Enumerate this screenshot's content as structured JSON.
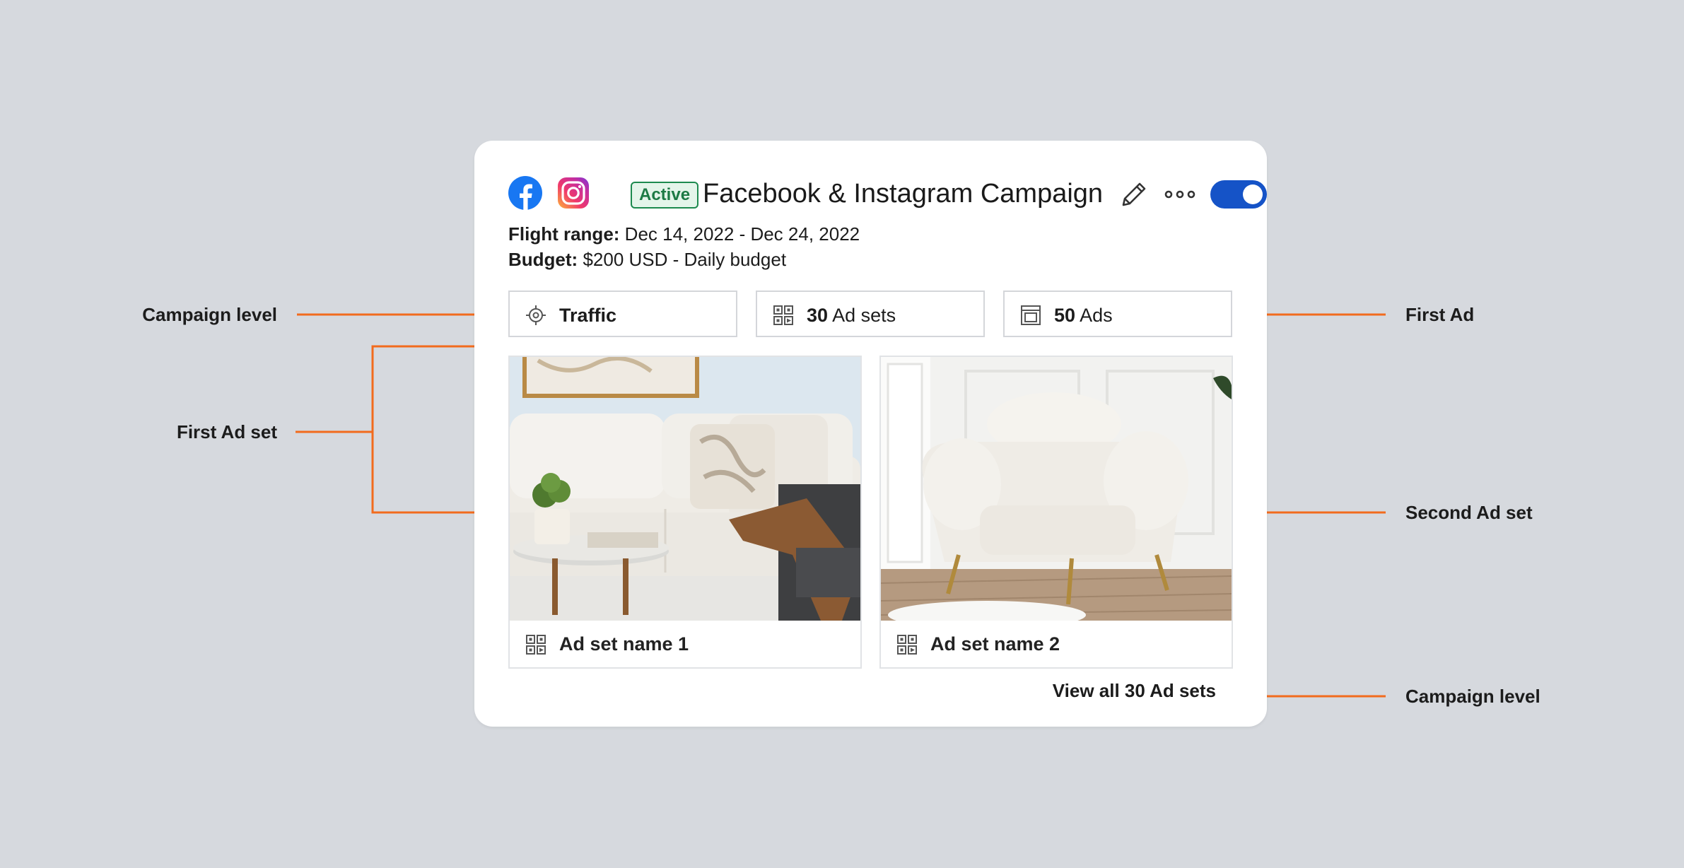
{
  "campaign": {
    "status": "Active",
    "title": "Facebook & Instagram Campaign",
    "flight_label": "Flight range:",
    "flight_value": "Dec 14, 2022 - Dec 24, 2022",
    "budget_label": "Budget:",
    "budget_value": "$200 USD - Daily budget",
    "toggle_on": true
  },
  "stats": {
    "objective": "Traffic",
    "adsets_count": "30",
    "adsets_label": "Ad sets",
    "ads_count": "50",
    "ads_label": "Ads"
  },
  "adsets": [
    {
      "name": "Ad set name 1"
    },
    {
      "name": "Ad set name 2"
    }
  ],
  "view_all": "View all 30 Ad sets",
  "annotations": {
    "campaign_level_top": "Campaign level",
    "first_ad_set": "First Ad set",
    "first_ad": "First Ad",
    "second_ad_set": "Second Ad set",
    "campaign_level_bottom": "Campaign level"
  },
  "colors": {
    "background": "#d6d9de",
    "accent_line": "#f26b1d",
    "toggle": "#1553c7",
    "active_badge": "#1d8a4f",
    "facebook": "#1877f2"
  }
}
